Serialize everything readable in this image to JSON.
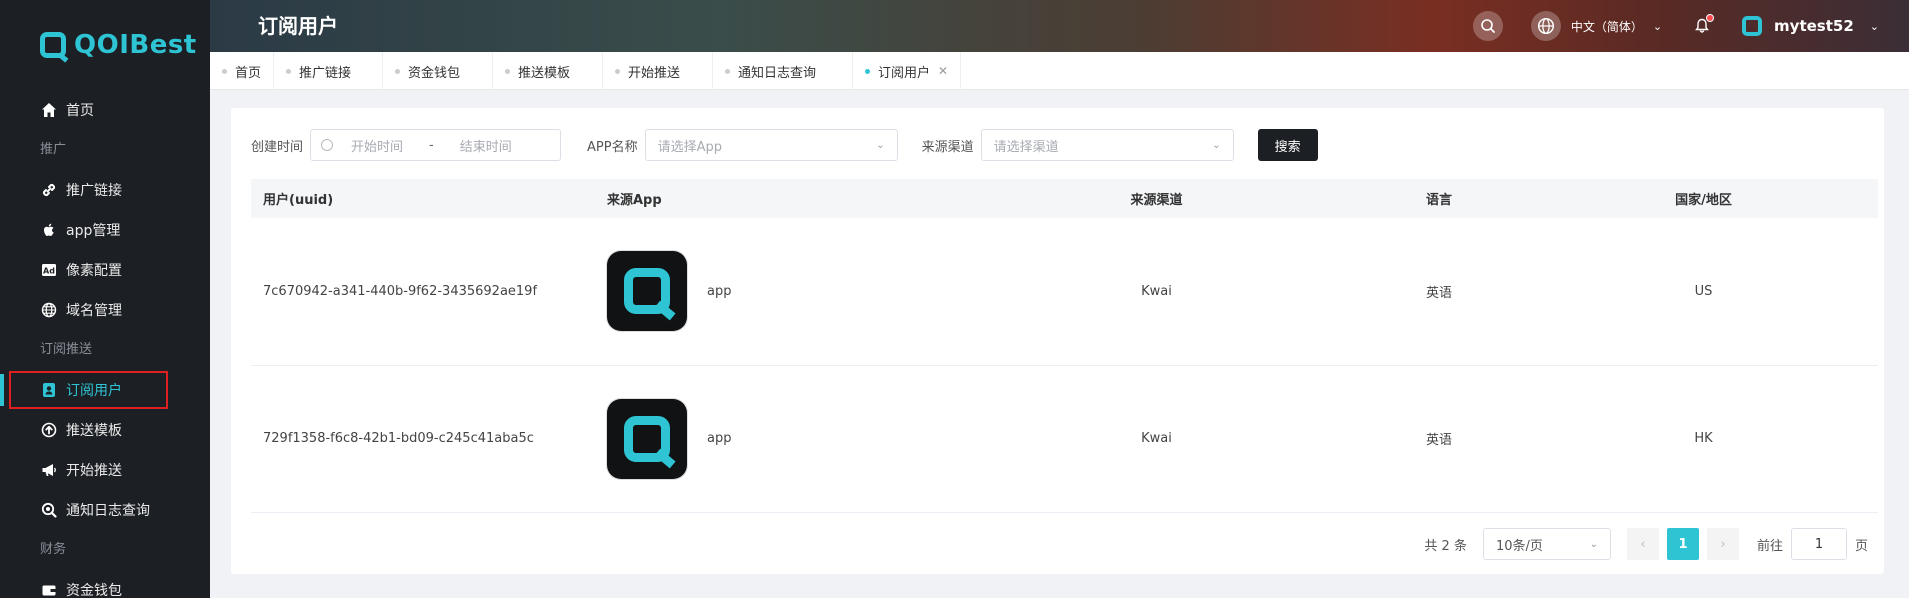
{
  "brand": {
    "name": "QOIBest"
  },
  "sidebar": {
    "items": [
      {
        "type": "item",
        "label": "首页",
        "icon": "home-icon"
      },
      {
        "type": "group",
        "label": "推广"
      },
      {
        "type": "item",
        "label": "推广链接",
        "icon": "link-icon"
      },
      {
        "type": "item",
        "label": "app管理",
        "icon": "apple-icon"
      },
      {
        "type": "item",
        "label": "像素配置",
        "icon": "ad-icon"
      },
      {
        "type": "item",
        "label": "域名管理",
        "icon": "globe-icon"
      },
      {
        "type": "group",
        "label": "订阅推送"
      },
      {
        "type": "item",
        "label": "订阅用户",
        "icon": "user-card-icon",
        "active": true
      },
      {
        "type": "item",
        "label": "推送模板",
        "icon": "upload-circle-icon"
      },
      {
        "type": "item",
        "label": "开始推送",
        "icon": "megaphone-icon"
      },
      {
        "type": "item",
        "label": "通知日志查询",
        "icon": "search-log-icon"
      },
      {
        "type": "group",
        "label": "财务"
      },
      {
        "type": "item",
        "label": "资金钱包",
        "icon": "wallet-icon"
      }
    ]
  },
  "header": {
    "title": "订阅用户",
    "language": "中文（简体）",
    "username": "mytest52"
  },
  "tabs": [
    {
      "label": "首页",
      "closable": false,
      "active": false
    },
    {
      "label": "推广链接",
      "closable": false,
      "active": false
    },
    {
      "label": "资金钱包",
      "closable": false,
      "active": false
    },
    {
      "label": "推送模板",
      "closable": false,
      "active": false
    },
    {
      "label": "开始推送",
      "closable": false,
      "active": false
    },
    {
      "label": "通知日志查询",
      "closable": false,
      "active": false
    },
    {
      "label": "订阅用户",
      "closable": true,
      "active": true
    }
  ],
  "filters": {
    "created_label": "创建时间",
    "start_placeholder": "开始时间",
    "range_separator": "-",
    "end_placeholder": "结束时间",
    "app_label": "APP名称",
    "app_placeholder": "请选择App",
    "channel_label": "来源渠道",
    "channel_placeholder": "请选择渠道",
    "search_button": "搜索"
  },
  "table": {
    "columns": [
      "用户(uuid)",
      "来源App",
      "来源渠道",
      "语言",
      "国家/地区"
    ],
    "rows": [
      {
        "uuid": "7c670942-a341-440b-9f62-3435692ae19f",
        "app": "app",
        "channel": "Kwai",
        "language": "英语",
        "country": "US"
      },
      {
        "uuid": "729f1358-f6c8-42b1-bd09-c245c41aba5c",
        "app": "app",
        "channel": "Kwai",
        "language": "英语",
        "country": "HK"
      }
    ]
  },
  "pagination": {
    "total": "共 2 条",
    "page_size": "10条/页",
    "current_page": "1",
    "goto_label": "前往",
    "goto_value": "1",
    "page_unit": "页"
  },
  "colors": {
    "accent": "#2ec4d3",
    "sidebar_bg": "#1c1f24",
    "highlight_box": "#e02020"
  }
}
